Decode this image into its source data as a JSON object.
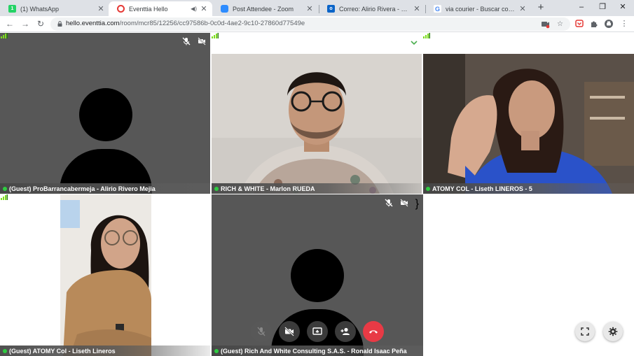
{
  "browser": {
    "tabs": [
      {
        "label": "(1) WhatsApp",
        "favicon": "whatsapp-icon",
        "color": "#25d366",
        "glyph": "1"
      },
      {
        "label": "Eventtia Hello",
        "favicon": "eventtia-icon",
        "color": "#e53935",
        "glyph": "e",
        "active": true
      },
      {
        "label": "Post Attendee - Zoom",
        "favicon": "zoom-icon",
        "color": "#2d8cff",
        "glyph": "z"
      },
      {
        "label": "Correo: Alirio Rivera - Outlook",
        "favicon": "outlook-icon",
        "color": "#0a64c8",
        "glyph": "o"
      },
      {
        "label": "via courier - Buscar con Google",
        "favicon": "google-icon",
        "color": "#ffffff",
        "glyph": "G"
      }
    ],
    "new_tab": "+",
    "window_controls": {
      "minimize": "–",
      "restore": "❐",
      "close": "✕"
    },
    "url": {
      "host": "hello.eventtia.com",
      "path": "/room/mcr85/12256/cc97586b-0c0d-4ae2-9c10-27860d77549e"
    }
  },
  "participants": [
    {
      "name": "(Guest) ProBarrancabermeja - Alirio Rivero Mejia",
      "video": false,
      "muted": true,
      "status": "online"
    },
    {
      "name": "RICH & WHITE - Marlon RUEDA",
      "video": true,
      "status": "online"
    },
    {
      "name": "ATOMY COL - Liseth LINEROS - 5",
      "video": true,
      "status": "online"
    },
    {
      "name": "(Guest) ATOMY Col - Liseth Lineros",
      "video": true,
      "status": "online"
    },
    {
      "name": "(Guest) Rich And White Consulting S.A.S. - Ronald Isaac Peña",
      "video": false,
      "muted": true,
      "status": "online"
    }
  ],
  "controls": [
    {
      "name": "microphone-button",
      "icon": "mic-off-icon"
    },
    {
      "name": "camera-button",
      "icon": "video-off-icon"
    },
    {
      "name": "share-screen-button",
      "icon": "screen-share-icon"
    },
    {
      "name": "participants-button",
      "icon": "add-person-icon"
    },
    {
      "name": "hang-up-button",
      "icon": "phone-hangup-icon"
    }
  ],
  "colors": {
    "tile_dark": "#575757",
    "online": "#2ecc40",
    "hangup": "#e83a45"
  }
}
